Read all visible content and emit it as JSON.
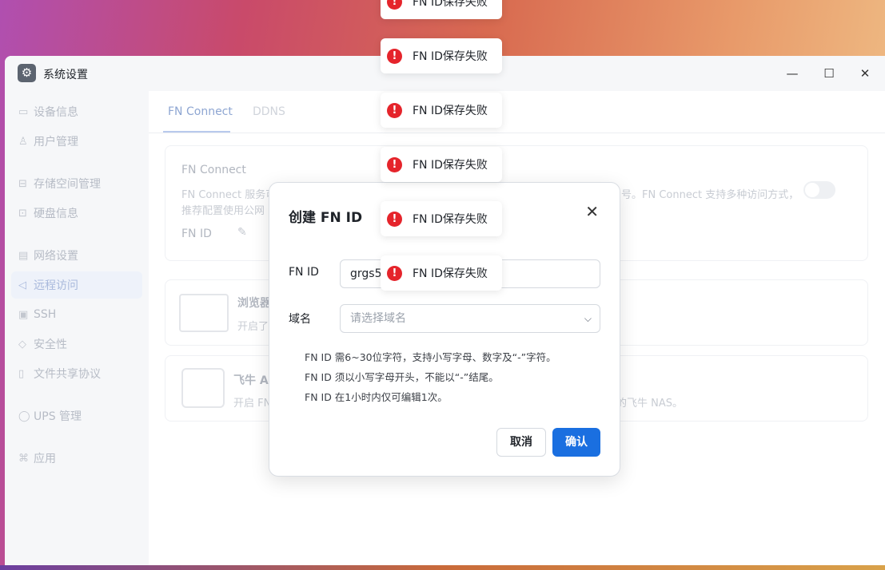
{
  "window": {
    "title": "系统设置",
    "controls": {
      "minimize": "—",
      "maximize": "☐",
      "close": "✕"
    }
  },
  "sidebar": {
    "items": [
      {
        "label": "设备信息",
        "icon": "monitor-icon"
      },
      {
        "label": "用户管理",
        "icon": "user-icon"
      },
      {
        "label": "存储空间管理",
        "icon": "storage-icon"
      },
      {
        "label": "硬盘信息",
        "icon": "disk-icon"
      },
      {
        "label": "网络设置",
        "icon": "network-icon"
      },
      {
        "label": "远程访问",
        "icon": "send-icon"
      },
      {
        "label": "SSH",
        "icon": "terminal-icon"
      },
      {
        "label": "安全性",
        "icon": "shield-icon"
      },
      {
        "label": "文件共享协议",
        "icon": "file-icon"
      },
      {
        "label": "UPS 管理",
        "icon": "ups-icon"
      },
      {
        "label": "应用",
        "icon": "apps-icon"
      }
    ],
    "active": "远程访问"
  },
  "tabs": [
    {
      "label": "FN Connect"
    },
    {
      "label": "DDNS"
    }
  ],
  "fn_connect_card": {
    "title": "FN Connect",
    "desc_line1": "FN Connect 服务可",
    "desc_line1_right": "号。FN Connect 支持多种访问方式，",
    "desc_line2": "推荐配置使用公网",
    "fn_id_label": "FN ID"
  },
  "browser_card": {
    "title": "浏览器",
    "desc": "开启了"
  },
  "app_card": {
    "title": "飞牛 Ap",
    "desc": "开启 FN",
    "desc_right": "的飞牛 NAS。"
  },
  "dialog": {
    "title": "创建 FN ID",
    "fn_id_label": "FN ID",
    "fn_id_value": "grgs50",
    "domain_label": "域名",
    "domain_placeholder": "请选择域名",
    "hints": [
      "FN ID 需6~30位字符，支持小写字母、数字及“-”字符。",
      "FN ID 须以小写字母开头，不能以“-”结尾。",
      "FN ID 在1小时内仅可编辑1次。"
    ],
    "cancel_label": "取消",
    "confirm_label": "确认"
  },
  "toasts": [
    "FN ID保存失败",
    "FN ID保存失败",
    "FN ID保存失败",
    "FN ID保存失败",
    "FN ID保存失败",
    "FN ID保存失败"
  ],
  "colors": {
    "accent": "#1a6fe0",
    "error": "#e5242b"
  }
}
